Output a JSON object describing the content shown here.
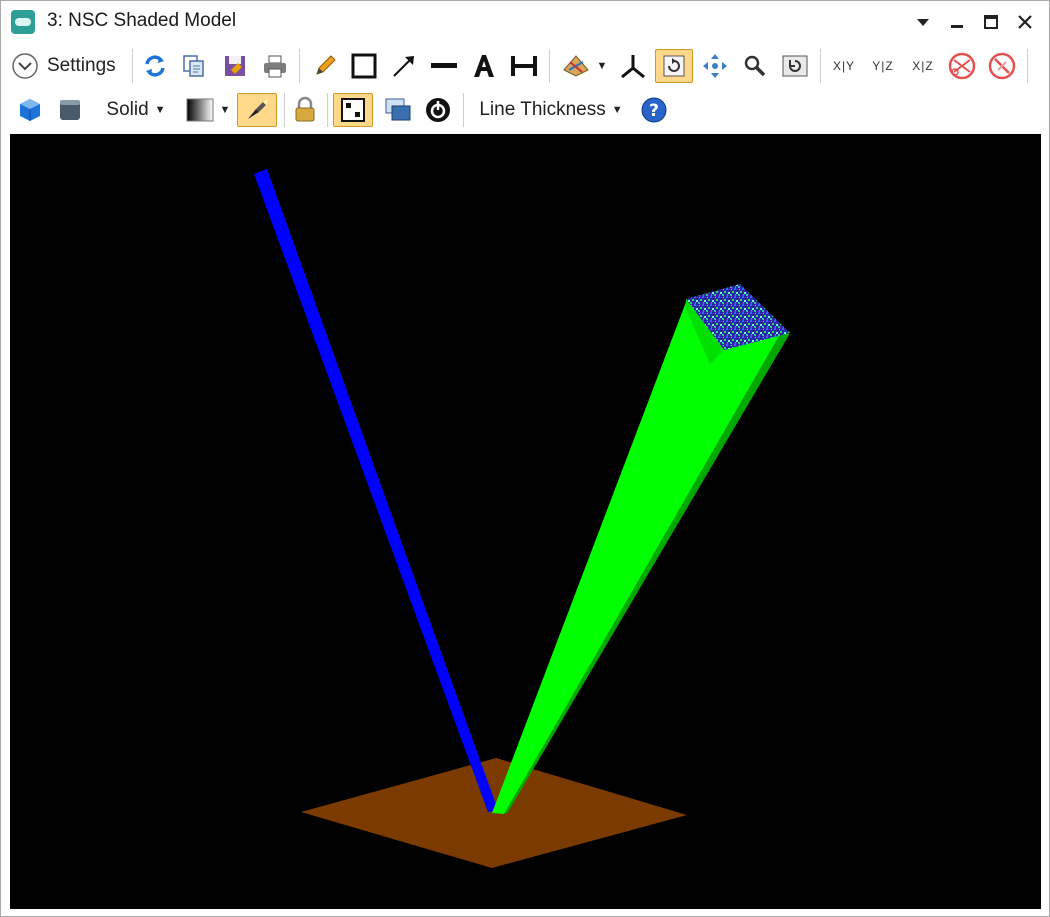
{
  "window": {
    "title": "3: NSC Shaded Model"
  },
  "window_controls": {
    "menu_icon": "dropdown-arrow-icon",
    "minimize_icon": "minimize-icon",
    "maximize_icon": "maximize-icon",
    "close_icon": "close-icon"
  },
  "toolbar": {
    "settings_label": "Settings",
    "mode_label": "Solid",
    "line_thickness_label": "Line Thickness",
    "axis_xy": "X|Y",
    "axis_yz": "Y|Z",
    "axis_xz": "X|Z"
  },
  "colors": {
    "viewport_background": "#000000",
    "blue_source": "#0000ff",
    "green_beam": "#00ff00",
    "detector_surface": "#7a3a00",
    "active_button": "#ffd88a"
  }
}
